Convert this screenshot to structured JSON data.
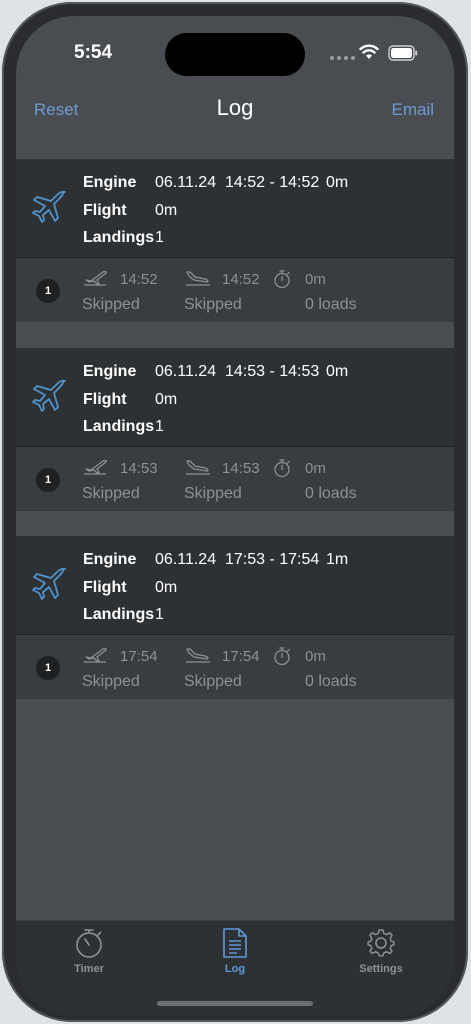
{
  "status": {
    "time": "5:54"
  },
  "nav": {
    "left": "Reset",
    "title": "Log",
    "right": "Email"
  },
  "labels": {
    "engine": "Engine",
    "flight": "Flight",
    "landings": "Landings"
  },
  "entries": [
    {
      "date": "06.11.24",
      "range": "14:52 - 14:52",
      "engine_duration": "0m",
      "flight": "0m",
      "landings": "1",
      "badge": "1",
      "takeoff_time": "14:52",
      "landing_time": "14:52",
      "timer_value": "0m",
      "takeoff_status": "Skipped",
      "landing_status": "Skipped",
      "loads": "0 loads"
    },
    {
      "date": "06.11.24",
      "range": "14:53 - 14:53",
      "engine_duration": "0m",
      "flight": "0m",
      "landings": "1",
      "badge": "1",
      "takeoff_time": "14:53",
      "landing_time": "14:53",
      "timer_value": "0m",
      "takeoff_status": "Skipped",
      "landing_status": "Skipped",
      "loads": "0 loads"
    },
    {
      "date": "06.11.24",
      "range": "17:53 - 17:54",
      "engine_duration": "1m",
      "flight": "0m",
      "landings": "1",
      "badge": "1",
      "takeoff_time": "17:54",
      "landing_time": "17:54",
      "timer_value": "0m",
      "takeoff_status": "Skipped",
      "landing_status": "Skipped",
      "loads": "0 loads"
    }
  ],
  "tabs": [
    {
      "label": "Timer",
      "icon": "stopwatch-icon",
      "active": false
    },
    {
      "label": "Log",
      "icon": "document-icon",
      "active": true
    },
    {
      "label": "Settings",
      "icon": "gear-icon",
      "active": false
    }
  ],
  "colors": {
    "accent": "#5f98d8",
    "background": "#494c50",
    "card": "#2e3134",
    "sub_card": "#393c40"
  }
}
